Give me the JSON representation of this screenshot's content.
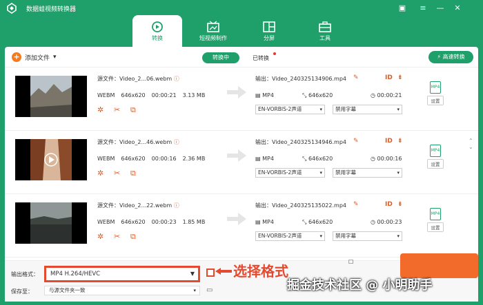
{
  "app": {
    "title": "数据蛙视频转换器"
  },
  "nav_tabs": [
    {
      "label": "转换"
    },
    {
      "label": "短视频制作"
    },
    {
      "label": "分屏"
    },
    {
      "label": "工具"
    }
  ],
  "toolbar": {
    "add_file": "添加文件",
    "tab_converting": "转换中",
    "tab_converted": "已转换",
    "fast_convert": "高速转换"
  },
  "rows": [
    {
      "source": "源文件：Video_2...06.webm",
      "format": "WEBM",
      "resolution": "646x620",
      "duration": "00:00:21",
      "size": "3.13 MB",
      "output": "输出：Video_240325134906.mp4",
      "out_format": "MP4",
      "out_resolution": "646x620",
      "out_duration": "00:00:21",
      "audio": "EN-VORBIS-2声道",
      "subtitle": "禁用字幕",
      "settings": "设置"
    },
    {
      "source": "源文件：Video_2...46.webm",
      "format": "WEBM",
      "resolution": "646x620",
      "duration": "00:00:16",
      "size": "2.36 MB",
      "output": "输出：Video_240325134946.mp4",
      "out_format": "MP4",
      "out_resolution": "646x620",
      "out_duration": "00:00:16",
      "audio": "EN-VORBIS-2声道",
      "subtitle": "禁用字幕",
      "settings": "设置"
    },
    {
      "source": "源文件：Video_2...22.webm",
      "format": "WEBM",
      "resolution": "646x620",
      "duration": "00:00:23",
      "size": "1.85 MB",
      "output": "输出：Video_240325135022.mp4",
      "out_format": "MP4",
      "out_resolution": "646x620",
      "out_duration": "00:00:23",
      "audio": "EN-VORBIS-2声道",
      "subtitle": "禁用字幕",
      "settings": "设置"
    }
  ],
  "bottom": {
    "format_label": "输出格式：",
    "format_value": "MP4 H.264/HEVC",
    "save_label": "保存至：",
    "save_value": "与源文件夹一致",
    "annotation": "选择格式",
    "watermark": "掘金技术社区 @ 小明助手"
  },
  "colors": {
    "brand_green": "#1fa06a",
    "accent_orange": "#f36b2a",
    "highlight_red": "#e64a2e"
  }
}
